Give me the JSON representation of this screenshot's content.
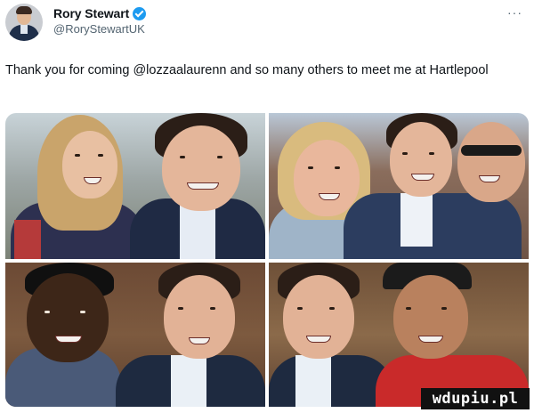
{
  "author": {
    "display_name": "Rory Stewart",
    "handle": "@RoryStewartUK",
    "verified": true,
    "verified_color": "#1d9bf0"
  },
  "more_menu": {
    "label": "···",
    "icon": "more-horizontal-icon"
  },
  "tweet": {
    "text": "Thank you for coming @lozzaalaurenn and so many others to meet me at Hartlepool"
  },
  "media": {
    "photos": [
      {
        "description_key": "photo-1"
      },
      {
        "description_key": "photo-2"
      },
      {
        "description_key": "photo-3"
      },
      {
        "description_key": "photo-4"
      }
    ]
  },
  "watermark": {
    "text": "wdupiu.pl"
  }
}
